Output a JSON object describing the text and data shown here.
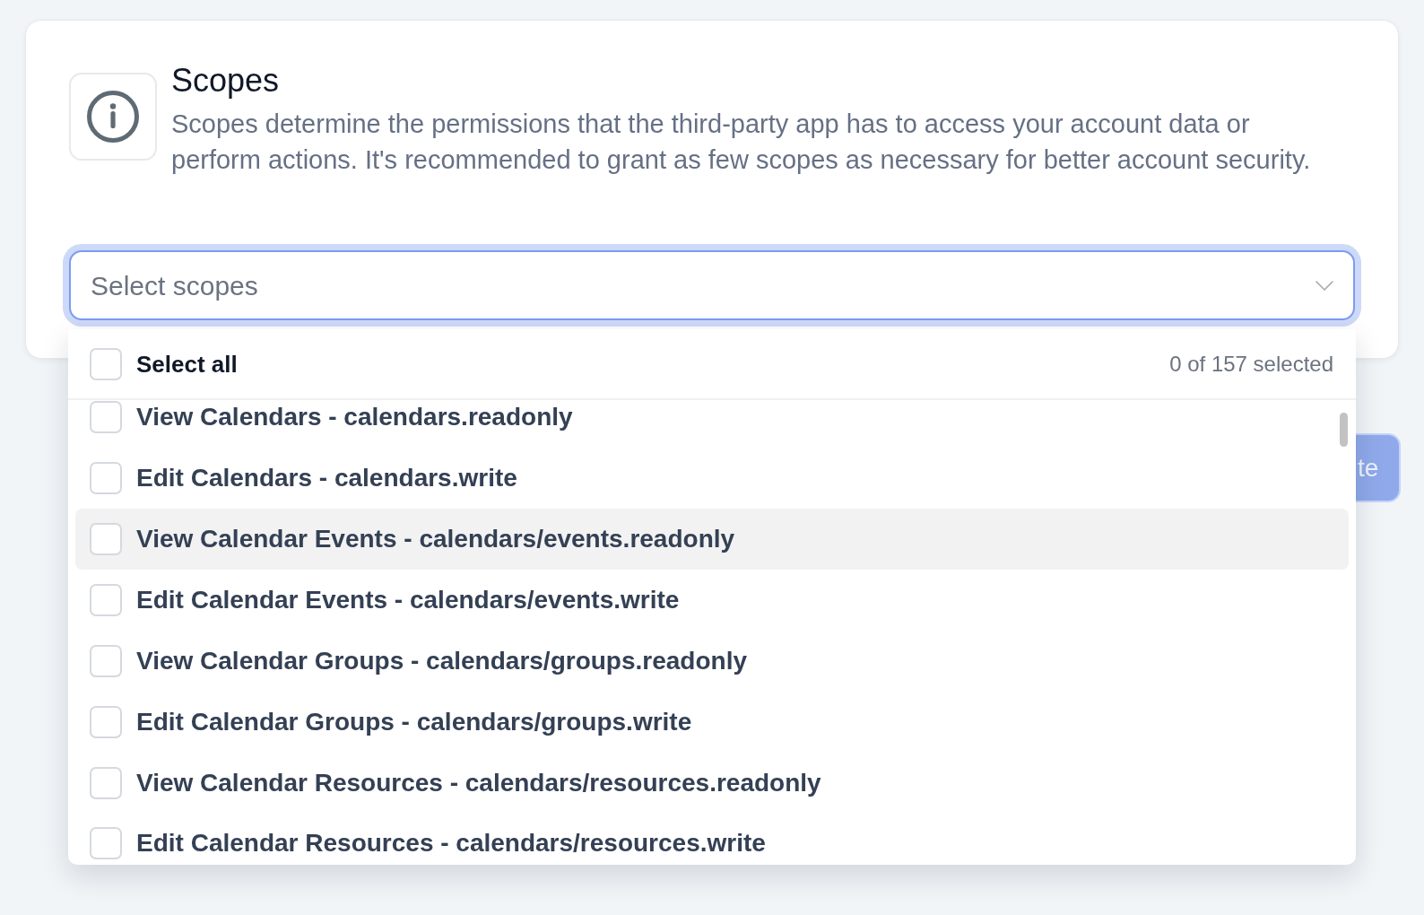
{
  "info": {
    "title": "Scopes",
    "description": "Scopes determine the permissions that the third-party app has to access your account data or perform actions. It's recommended to grant as few scopes as necessary for better account security."
  },
  "scope_select": {
    "placeholder": "Select scopes",
    "focused": true,
    "expanded": true
  },
  "dropdown": {
    "select_all": {
      "label": "Select all",
      "checked": false
    },
    "count": "0 of 157 selected",
    "options": [
      {
        "label": "View Calendars - calendars.readonly",
        "checked": false,
        "highlighted": false
      },
      {
        "label": "Edit Calendars - calendars.write",
        "checked": false,
        "highlighted": false
      },
      {
        "label": "View Calendar Events - calendars/events.readonly",
        "checked": false,
        "highlighted": true
      },
      {
        "label": "Edit Calendar Events - calendars/events.write",
        "checked": false,
        "highlighted": false
      },
      {
        "label": "View Calendar Groups - calendars/groups.readonly",
        "checked": false,
        "highlighted": false
      },
      {
        "label": "Edit Calendar Groups - calendars/groups.write",
        "checked": false,
        "highlighted": false
      },
      {
        "label": "View Calendar Resources - calendars/resources.readonly",
        "checked": false,
        "highlighted": false
      },
      {
        "label": "Edit Calendar Resources - calendars/resources.write",
        "checked": false,
        "highlighted": false
      }
    ]
  },
  "button": {
    "label": "te"
  }
}
